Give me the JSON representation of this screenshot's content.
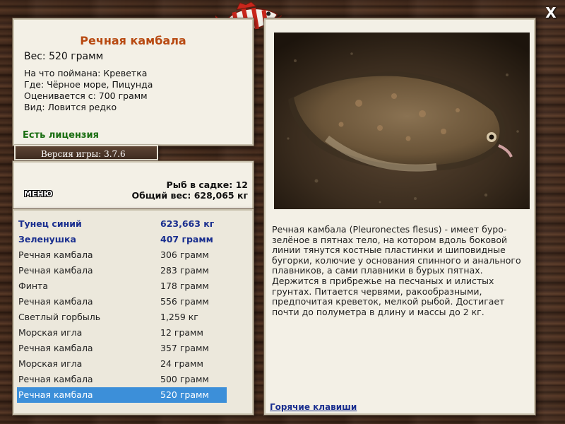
{
  "info": {
    "fish_name": "Речная камбала",
    "weight": "Вес: 520 грамм",
    "caught_on": "На что поймана: Креветка",
    "where": "Где: Чёрное море, Пицунда",
    "value": "Оценивается с: 700 грамм",
    "kind": "Вид: Ловится редко",
    "license": "Есть лицензия"
  },
  "version": "Версия игры: 3.7.6",
  "stats": {
    "fish_in_keepnet": "Рыб в садке: 12",
    "total_weight": "Общий вес: 628,065 кг",
    "menu_label": "МЕНЮ"
  },
  "catch_list": [
    {
      "name": "Тунец синий",
      "weight": "623,663 кг",
      "record": true
    },
    {
      "name": "Зеленушка",
      "weight": "407 грамм",
      "record": true
    },
    {
      "name": "Речная камбала",
      "weight": "306 грамм"
    },
    {
      "name": "Речная камбала",
      "weight": "283 грамм"
    },
    {
      "name": "Финта",
      "weight": "178 грамм"
    },
    {
      "name": "Речная камбала",
      "weight": "556 грамм"
    },
    {
      "name": "Светлый горбыль",
      "weight": "1,259 кг"
    },
    {
      "name": "Морская игла",
      "weight": "12 грамм"
    },
    {
      "name": "Речная камбала",
      "weight": "357 грамм"
    },
    {
      "name": "Морская игла",
      "weight": "24 грамм"
    },
    {
      "name": "Речная камбала",
      "weight": "500 грамм"
    },
    {
      "name": "Речная камбала",
      "weight": "520 грамм",
      "selected": true
    }
  ],
  "description": "Речная камбала (Pleuronectes flesus) - имеет буро-зелёное в пятнах тело, на котором вдоль боковой линии тянутся костные пластинки и шиповидные бугорки, колючие у основания спинного и анального плавников, а сами плавники в бурых пятнах. Держится в прибрежье на песчаных и илистых грунтах. Питается червями, ракообразными, предпочитая креветок, мелкой рыбой. Достигает почти до полуметра в длину и массы до 2 кг.",
  "hotkeys_label": "Горячие клавиши",
  "close_label": "X",
  "icons": {
    "close": "close-icon",
    "logo": "fish-logo-icon"
  },
  "colors": {
    "title": "#b84a12",
    "license": "#1a6e12",
    "record_text": "#1a2f8f",
    "selection": "#3c8fd9",
    "panel_bg": "#f3f0e6"
  }
}
